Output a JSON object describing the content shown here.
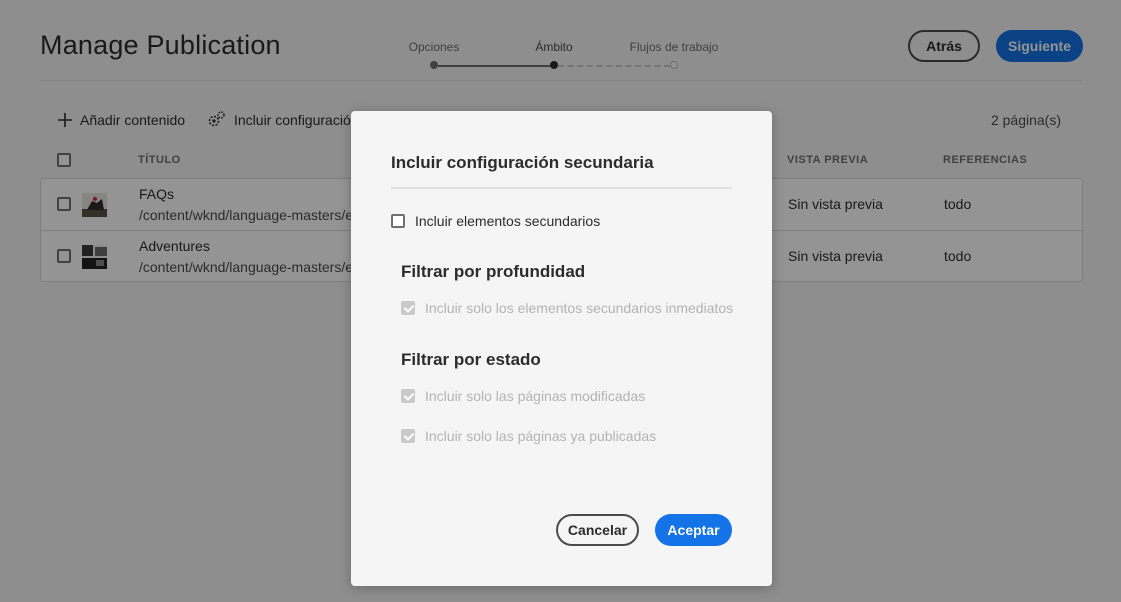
{
  "header": {
    "title": "Manage Publication",
    "steps": [
      {
        "label": "Opciones",
        "state": "done"
      },
      {
        "label": "Ámbito",
        "state": "current"
      },
      {
        "label": "Flujos de trabajo",
        "state": "todo"
      }
    ],
    "back_label": "Atrás",
    "next_label": "Siguiente"
  },
  "toolbar": {
    "add_content_label": "Añadir contenido",
    "add_content_icon": "plus-icon",
    "include_config_label": "Incluir configuración s",
    "include_config_icon": "gears-icon",
    "page_count": "2 página(s)"
  },
  "table": {
    "columns": [
      "TÍTULO",
      "VISTA PREVIA",
      "REFERENCIAS"
    ],
    "rows": [
      {
        "title": "FAQs",
        "path": "/content/wknd/language-masters/en/",
        "preview": "Sin vista previa",
        "references": "todo"
      },
      {
        "title": "Adventures",
        "path": "/content/wknd/language-masters/en/",
        "preview": "Sin vista previa",
        "references": "todo"
      }
    ]
  },
  "dialog": {
    "title": "Incluir configuración secundaria",
    "include_children_label": "Incluir elementos secundarios",
    "depth_heading": "Filtrar por profundidad",
    "immediate_children_label": "Incluir solo los elementos secundarios inmediatos",
    "status_heading": "Filtrar por estado",
    "modified_label": "Incluir solo las páginas modificadas",
    "published_label": "Incluir solo las páginas ya publicadas",
    "cancel_label": "Cancelar",
    "accept_label": "Aceptar"
  },
  "colors": {
    "accent": "#1473e6",
    "overlay": "rgba(0,0,0,0.42)"
  }
}
